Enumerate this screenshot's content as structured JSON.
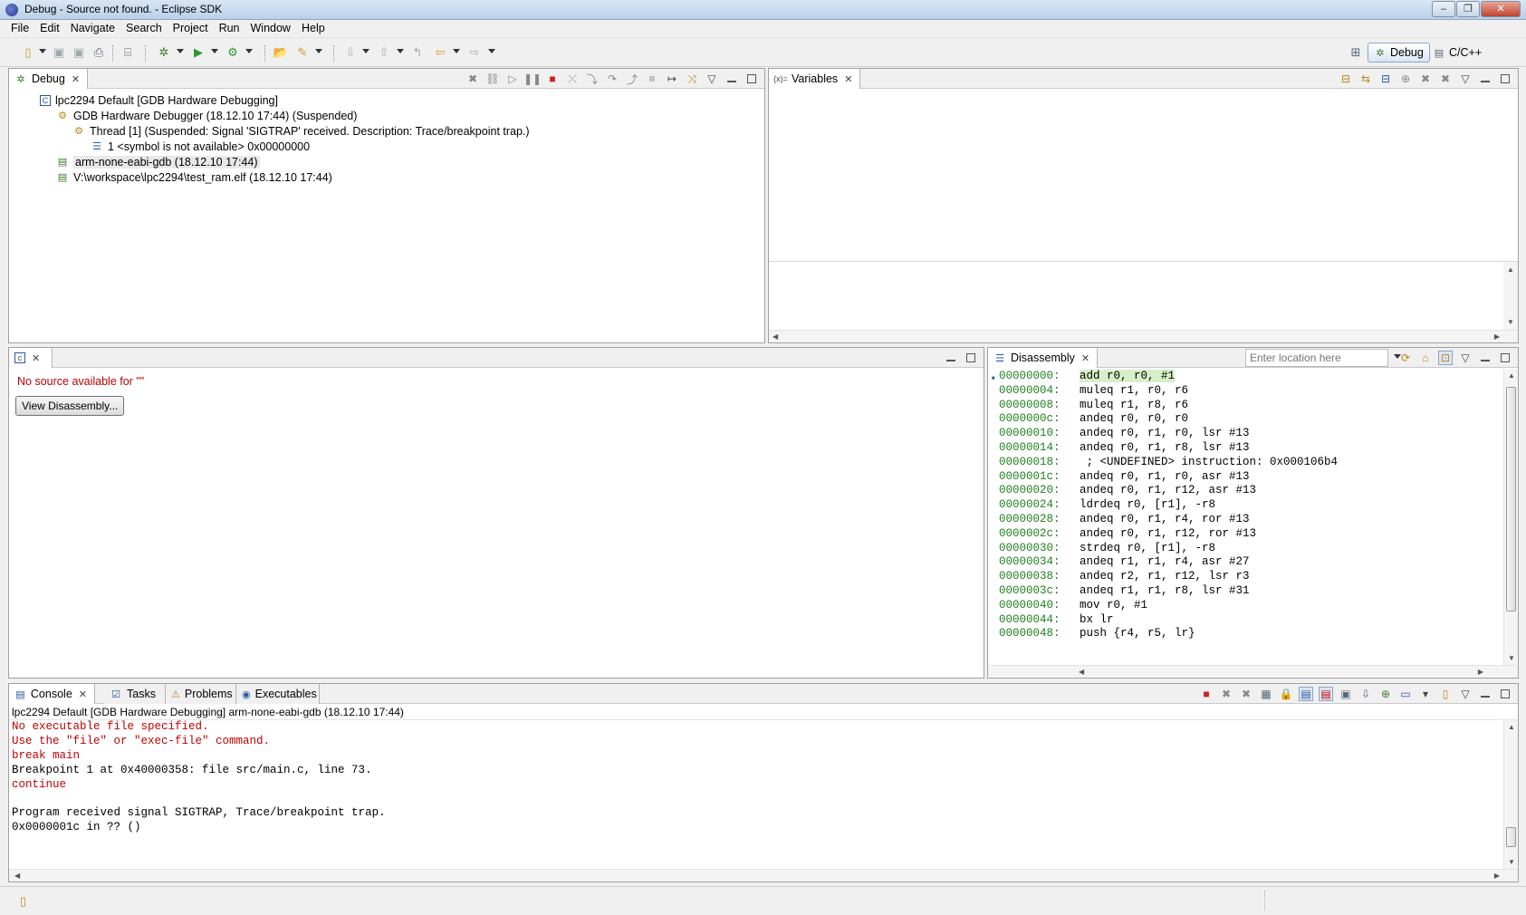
{
  "window": {
    "title": "Debug - Source not found. - Eclipse SDK"
  },
  "menu": [
    "File",
    "Edit",
    "Navigate",
    "Search",
    "Project",
    "Run",
    "Window",
    "Help"
  ],
  "perspectives": {
    "debug": "Debug",
    "cpp": "C/C++"
  },
  "debug_view": {
    "tab": "Debug",
    "tree": [
      "lpc2294 Default [GDB Hardware Debugging]",
      "GDB Hardware Debugger (18.12.10 17:44) (Suspended)",
      "Thread [1] (Suspended: Signal 'SIGTRAP' received. Description: Trace/breakpoint trap.)",
      "1 <symbol is not available> 0x00000000",
      "arm-none-eabi-gdb (18.12.10 17:44)",
      "V:\\workspace\\lpc2294\\test_ram.elf (18.12.10 17:44)"
    ]
  },
  "variables_view": {
    "tab": "Variables"
  },
  "source_view": {
    "message": "No source available for \"\"",
    "button": "View Disassembly..."
  },
  "disassembly": {
    "tab": "Disassembly",
    "location_placeholder": "Enter location here",
    "rows": [
      {
        "addr": "00000000:",
        "code": "add r0, r0, #1"
      },
      {
        "addr": "00000004:",
        "code": "muleq r1, r0, r6"
      },
      {
        "addr": "00000008:",
        "code": "muleq r1, r8, r6"
      },
      {
        "addr": "0000000c:",
        "code": "andeq r0, r0, r0"
      },
      {
        "addr": "00000010:",
        "code": "andeq r0, r1, r0, lsr #13"
      },
      {
        "addr": "00000014:",
        "code": "andeq r0, r1, r8, lsr #13"
      },
      {
        "addr": "00000018:",
        "code": " ; <UNDEFINED> instruction: 0x000106b4"
      },
      {
        "addr": "0000001c:",
        "code": "andeq r0, r1, r0, asr #13"
      },
      {
        "addr": "00000020:",
        "code": "andeq r0, r1, r12, asr #13"
      },
      {
        "addr": "00000024:",
        "code": "ldrdeq r0, [r1], -r8"
      },
      {
        "addr": "00000028:",
        "code": "andeq r0, r1, r4, ror #13"
      },
      {
        "addr": "0000002c:",
        "code": "andeq r0, r1, r12, ror #13"
      },
      {
        "addr": "00000030:",
        "code": "strdeq r0, [r1], -r8"
      },
      {
        "addr": "00000034:",
        "code": "andeq r1, r1, r4, asr #27"
      },
      {
        "addr": "00000038:",
        "code": "andeq r2, r1, r12, lsr r3"
      },
      {
        "addr": "0000003c:",
        "code": "andeq r1, r1, r8, lsr #31"
      },
      {
        "addr": "00000040:",
        "code": "mov r0, #1"
      },
      {
        "addr": "00000044:",
        "code": "bx lr"
      },
      {
        "addr": "00000048:",
        "code": "push {r4, r5, lr}"
      }
    ]
  },
  "console": {
    "tabs": [
      "Console",
      "Tasks",
      "Problems",
      "Executables"
    ],
    "subtitle": "lpc2294 Default [GDB Hardware Debugging] arm-none-eabi-gdb (18.12.10 17:44)",
    "lines": [
      {
        "text": "No executable file specified.",
        "error": true
      },
      {
        "text": "Use the \"file\" or \"exec-file\" command.",
        "error": true
      },
      {
        "text": "break main",
        "error": true
      },
      {
        "text": "Breakpoint 1 at 0x40000358: file src/main.c, line 73.",
        "error": false
      },
      {
        "text": "continue",
        "error": true
      },
      {
        "text": "",
        "error": false
      },
      {
        "text": "Program received signal SIGTRAP, Trace/breakpoint trap.",
        "error": false
      },
      {
        "text": "0x0000001c in ?? ()",
        "error": false
      }
    ]
  },
  "colors": {
    "error_text": "#c00000",
    "address_green": "#208020",
    "current_line": "#d7efc9"
  }
}
